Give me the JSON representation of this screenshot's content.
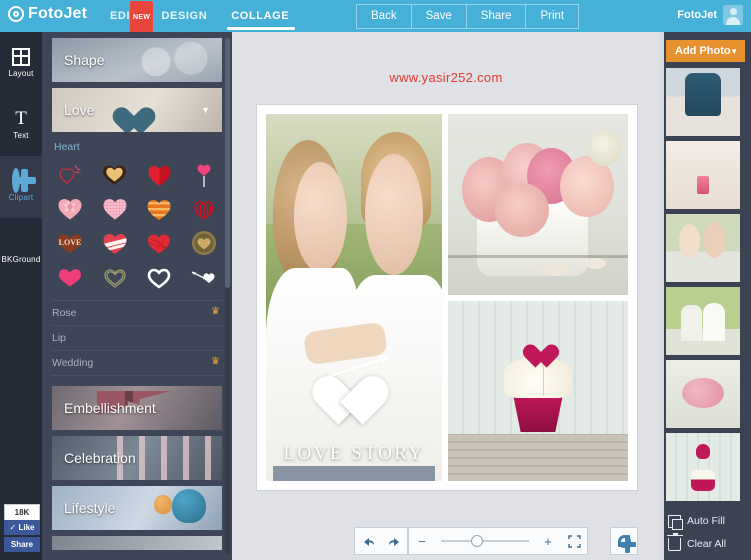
{
  "app": {
    "name": "FotoJet"
  },
  "topbar": {
    "logo_text": "FotoJet",
    "tabs": [
      {
        "label": "EDIT",
        "badge": "NEW",
        "active": false
      },
      {
        "label": "DESIGN",
        "badge": "",
        "active": false
      },
      {
        "label": "COLLAGE",
        "badge": "",
        "active": true
      }
    ],
    "buttons": [
      "Back",
      "Save",
      "Print",
      "Share"
    ],
    "back_label": "Back",
    "save_label": "Save",
    "share_label": "Share",
    "print_label": "Print",
    "user_name": "FotoJet"
  },
  "rail": {
    "items": [
      {
        "label": "Layout",
        "icon": "layout-icon",
        "active": false
      },
      {
        "label": "Text",
        "icon": "text-icon",
        "active": false
      },
      {
        "label": "Clipart",
        "icon": "gear-icon",
        "active": true
      },
      {
        "label": "BKGround",
        "icon": "background-icon",
        "active": false
      }
    ],
    "social": {
      "count": "18K",
      "like_label": "Like",
      "share_label": "Share"
    }
  },
  "panel": {
    "shape_label": "Shape",
    "love_label": "Love",
    "subhead": "Heart",
    "clipart": [
      "heart-doodle-pink",
      "heart-gold-chocolate",
      "heart-red-solid",
      "heart-lollipop-pink",
      "heart-crystal-pink",
      "heart-glitter-pink",
      "heart-striped-orange",
      "heart-ribbon-red",
      "heart-love-word",
      "heart-bandage-striped",
      "heart-scribble-red",
      "heart-medal-gold",
      "heart-pink-brush",
      "heart-outline-olive",
      "heart-outline-white",
      "heart-arrow-white"
    ],
    "categories": [
      {
        "label": "Rose",
        "premium": true
      },
      {
        "label": "Lip",
        "premium": false
      },
      {
        "label": "Wedding",
        "premium": true
      }
    ],
    "banners": [
      {
        "label": "Embellishment"
      },
      {
        "label": "Celebration"
      },
      {
        "label": "Lifestyle"
      }
    ]
  },
  "canvas": {
    "watermark": "www.yasir252.com",
    "collage_caption": "LOVE STORY",
    "photos": [
      {
        "name": "wedding-couple-foreheads-touching"
      },
      {
        "name": "pink-roses-in-white-pot"
      },
      {
        "name": "cupcake-with-heart-topper"
      }
    ]
  },
  "bottombar": {
    "undo_label": "Undo",
    "redo_label": "Redo",
    "zoom_out_label": "−",
    "zoom_in_label": "+",
    "fullscreen_label": "Fullscreen",
    "settings_label": "Settings"
  },
  "right": {
    "add_photo_label": "Add Photo",
    "auto_fill_label": "Auto Fill",
    "clear_all_label": "Clear All",
    "thumbnails": [
      {
        "name": "woman-teal-dress-beach"
      },
      {
        "name": "pink-candle-still-life"
      },
      {
        "name": "couple-kissing-close"
      },
      {
        "name": "couple-kissing-on-grass"
      },
      {
        "name": "pink-roses-bowl"
      },
      {
        "name": "cupcake-heart-topper"
      }
    ]
  },
  "colors": {
    "topbar": "#45b0d8",
    "accent_orange": "#e8912f",
    "panel_dark": "#3e4556",
    "rail_dark": "#262b38",
    "watermark_red": "#e23b2e",
    "premium_gold": "#e8a33d"
  }
}
